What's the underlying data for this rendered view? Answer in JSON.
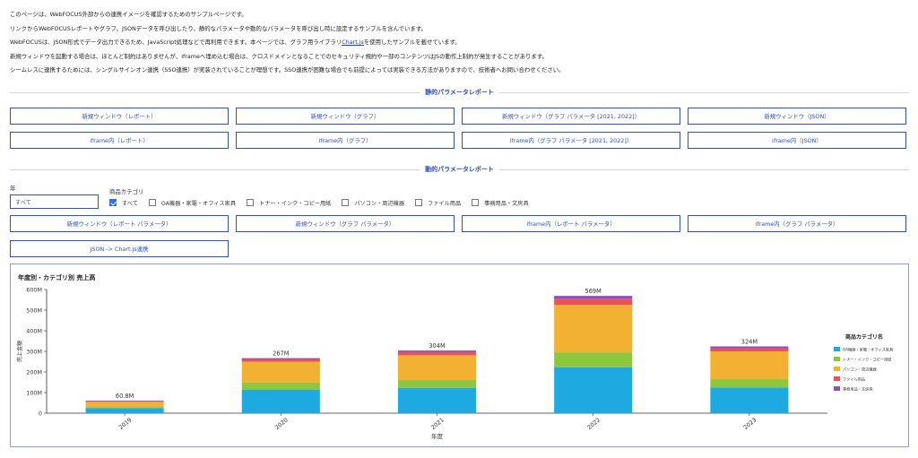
{
  "intro": {
    "line1": "このページは、WebFOCUS外部からの連携イメージを確認するためのサンプルページです。",
    "line2": "リンクからWebFOCUSレポートやグラフ、JSONデータを呼び出したり、静的なパラメータや動的なパラメータを呼び出し時に設定するサンプルを含んでいます。",
    "line3_before": "WebFOCUSは、JSON形式でデータ出力できるため、JavaScript処理などで再利用できます。本ページでは、グラフ用ライブラリ",
    "line3_link": "Chart.js",
    "line3_after": "を使用したサンプルを載せています。",
    "line4": "新規ウィンドウを起動する場合は、ほとんど制約はありませんが、iframeへ埋め込む場合は、クロスドメインとなることでのセキュリティ規約や一部のコンテンツはJSの動作上制約が発生することがあります。",
    "line5": "シームレスに連携するためには、シングルサインオン連携（SSO連携）が実装されていることが理想です。SSO連携が困難な場合でも前提によっては実装できる方法がありますので、技術者へお問い合わせください。"
  },
  "static_section": {
    "title": "静的パラメータレポート",
    "buttons": [
      "新規ウィンドウ（レポート）",
      "新規ウィンドウ（グラフ）",
      "新規ウィンドウ（グラフ パラメータ [2021, 2022]）",
      "新規ウィンドウ（JSON）",
      "iframe内（レポート）",
      "iframe内（グラフ）",
      "iframe内（グラフ パラメータ [2021, 2022]）",
      "iframe内（JSON）"
    ]
  },
  "dynamic_section": {
    "title": "動的パラメータレポート",
    "year_label": "年",
    "year_value": "すべて",
    "category_label": "商品カテゴリ",
    "checkboxes": [
      {
        "label": "すべて",
        "checked": true
      },
      {
        "label": "OA機器・家電・オフィス家具",
        "checked": false
      },
      {
        "label": "トナー・インク・コピー用紙",
        "checked": false
      },
      {
        "label": "パソコン・周辺機器",
        "checked": false
      },
      {
        "label": "ファイル用品",
        "checked": false
      },
      {
        "label": "事務用品・文房具",
        "checked": false
      }
    ],
    "buttons": [
      "新規ウィンドウ（レポート パラメータ）",
      "新規ウィンドウ（グラフ パラメータ）",
      "iframe内（レポート パラメータ）",
      "iframe内（グラフ パラメータ）"
    ],
    "json_button": "JSON -> Chart.js連携"
  },
  "chart_data": {
    "type": "bar",
    "stacked": true,
    "title": "年度別・カテゴリ別 売上高",
    "xlabel": "年度",
    "ylabel": "売上金額",
    "ylim": [
      0,
      600
    ],
    "y_ticks": [
      "0",
      "100M",
      "200M",
      "300M",
      "400M",
      "500M",
      "600M"
    ],
    "categories": [
      "2019",
      "2020",
      "2021",
      "2022",
      "2023"
    ],
    "totals": [
      "60.8M",
      "267M",
      "304M",
      "569M",
      "324M"
    ],
    "legend_title": "商品カテゴリ名",
    "legend_position": "right",
    "grid": false,
    "series": [
      {
        "name": "OA機器・家電・オフィス家具",
        "color": "#1ea9e1",
        "values": [
          25,
          113,
          123,
          223,
          125
        ]
      },
      {
        "name": "トナー・インク・コピー用紙",
        "color": "#8dc63f",
        "values": [
          5,
          35,
          38,
          72,
          40
        ]
      },
      {
        "name": "パソコン・周辺機器",
        "color": "#f3b134",
        "values": [
          25,
          102,
          120,
          230,
          135
        ]
      },
      {
        "name": "ファイル用品",
        "color": "#e8525b",
        "values": [
          4,
          11,
          15,
          30,
          15
        ]
      },
      {
        "name": "事務用品・文房具",
        "color": "#8b52b7",
        "values": [
          2,
          6,
          8,
          14,
          9
        ]
      }
    ]
  }
}
